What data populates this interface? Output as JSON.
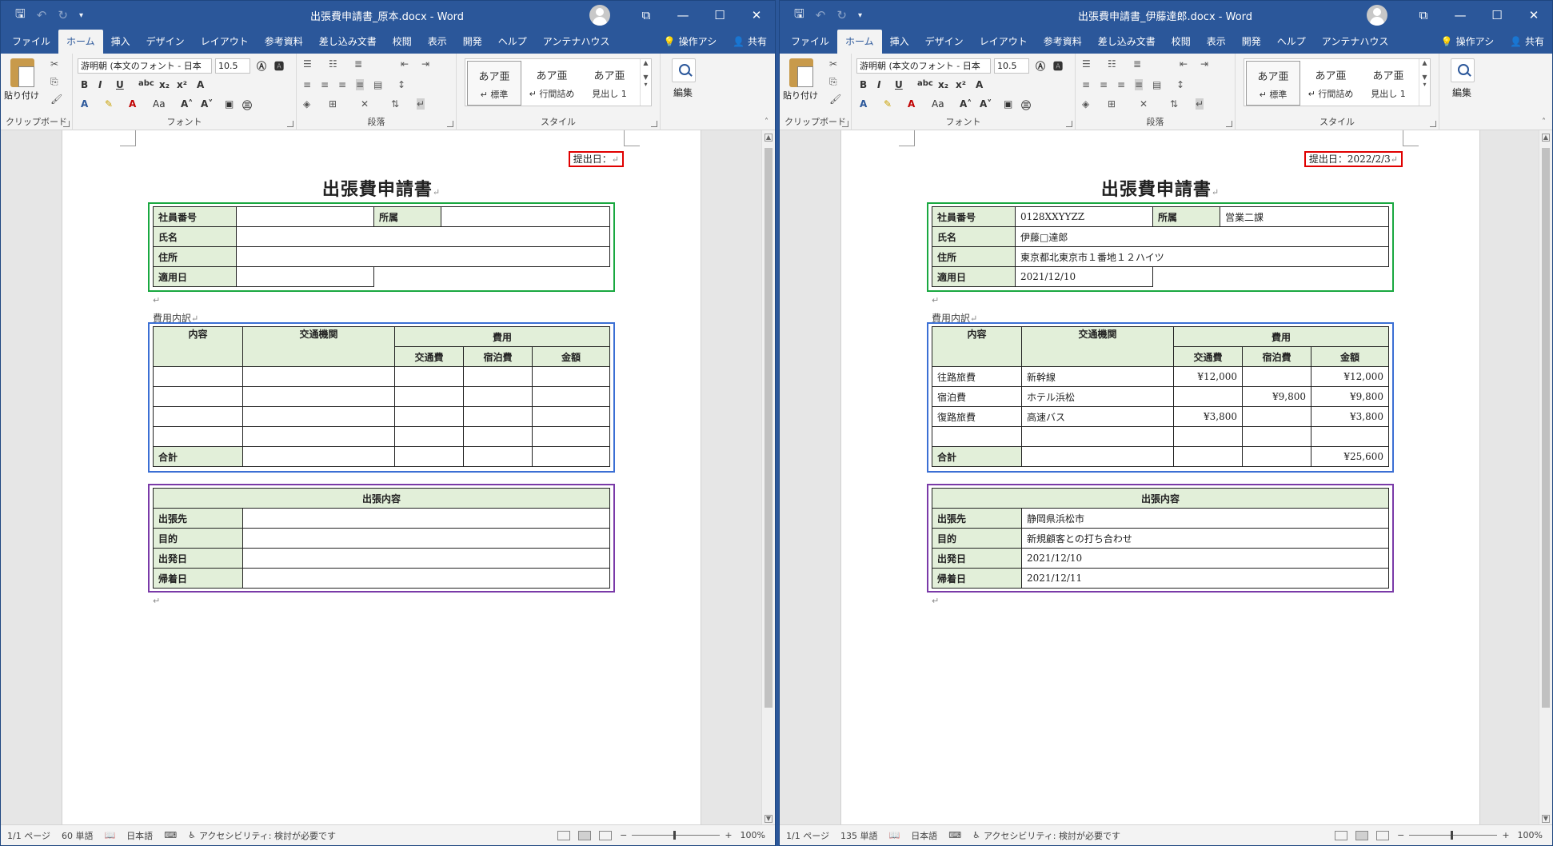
{
  "windows": [
    {
      "title": "出張費申請書_原本.docx  -  Word",
      "tabs": [
        "ファイル",
        "ホーム",
        "挿入",
        "デザイン",
        "レイアウト",
        "参考資料",
        "差し込み文書",
        "校閲",
        "表示",
        "開発",
        "ヘルプ",
        "アンテナハウス"
      ],
      "tell_me": "操作アシ",
      "share": "共有",
      "ribbon": {
        "paste": "貼り付け",
        "font_name": "游明朝 (本文のフォント - 日本",
        "font_size": "10.5",
        "clipboard": "クリップボード",
        "font": "フォント",
        "paragraph": "段落",
        "styles": "スタイル",
        "edit": "編集",
        "style_tiles": [
          {
            "sample": "あア亜",
            "name": "↵ 標準"
          },
          {
            "sample": "あア亜",
            "name": "↵ 行間詰め"
          },
          {
            "sample": "あア亜",
            "name": "見出し 1"
          }
        ]
      },
      "doc": {
        "submit_label": "提出日：",
        "title": "出張費申請書",
        "info": {
          "emp_no_label": "社員番号",
          "emp_no": "",
          "dept_label": "所属",
          "dept": "",
          "name_label": "氏名",
          "name": "",
          "addr_label": "住所",
          "addr": "",
          "apply_label": "適用日",
          "apply": ""
        },
        "expense_caption": "費用内訳",
        "expense_headers": {
          "content": "内容",
          "transport": "交通機関",
          "cost": "費用",
          "fare": "交通費",
          "lodging": "宿泊費",
          "amount": "金額"
        },
        "expense_rows": [
          {
            "content": "",
            "transport": "",
            "fare": "",
            "lodging": "",
            "amount": ""
          },
          {
            "content": "",
            "transport": "",
            "fare": "",
            "lodging": "",
            "amount": ""
          },
          {
            "content": "",
            "transport": "",
            "fare": "",
            "lodging": "",
            "amount": ""
          },
          {
            "content": "",
            "transport": "",
            "fare": "",
            "lodging": "",
            "amount": ""
          }
        ],
        "total_label": "合計",
        "total": "",
        "trip_header": "出張内容",
        "trip": {
          "dest_label": "出張先",
          "dest": "",
          "purpose_label": "目的",
          "purpose": "",
          "depart_label": "出発日",
          "depart": "",
          "return_label": "帰着日",
          "return": ""
        }
      },
      "status": {
        "page": "1/1 ページ",
        "words": "60 単語",
        "lang": "日本語",
        "access": "アクセシビリティ: 検討が必要です",
        "zoom": "100%"
      }
    },
    {
      "title": "出張費申請書_伊藤達郎.docx  -  Word",
      "tabs": [
        "ファイル",
        "ホーム",
        "挿入",
        "デザイン",
        "レイアウト",
        "参考資料",
        "差し込み文書",
        "校閲",
        "表示",
        "開発",
        "ヘルプ",
        "アンテナハウス"
      ],
      "tell_me": "操作アシ",
      "share": "共有",
      "ribbon": {
        "paste": "貼り付け",
        "font_name": "游明朝 (本文のフォント - 日本",
        "font_size": "10.5",
        "clipboard": "クリップボード",
        "font": "フォント",
        "paragraph": "段落",
        "styles": "スタイル",
        "edit": "編集",
        "style_tiles": [
          {
            "sample": "あア亜",
            "name": "↵ 標準"
          },
          {
            "sample": "あア亜",
            "name": "↵ 行間詰め"
          },
          {
            "sample": "あア亜",
            "name": "見出し 1"
          }
        ]
      },
      "doc": {
        "submit_label": "提出日：2022/2/3",
        "title": "出張費申請書",
        "info": {
          "emp_no_label": "社員番号",
          "emp_no": "0128XXYYZZ",
          "dept_label": "所属",
          "dept": "営業二課",
          "name_label": "氏名",
          "name": "伊藤□達郎",
          "addr_label": "住所",
          "addr": "東京都北東京市１番地１２ハイツ",
          "apply_label": "適用日",
          "apply": "2021/12/10"
        },
        "expense_caption": "費用内訳",
        "expense_headers": {
          "content": "内容",
          "transport": "交通機関",
          "cost": "費用",
          "fare": "交通費",
          "lodging": "宿泊費",
          "amount": "金額"
        },
        "expense_rows": [
          {
            "content": "往路旅費",
            "transport": "新幹線",
            "fare": "¥12,000",
            "lodging": "",
            "amount": "¥12,000"
          },
          {
            "content": "宿泊費",
            "transport": "ホテル浜松",
            "fare": "",
            "lodging": "¥9,800",
            "amount": "¥9,800"
          },
          {
            "content": "復路旅費",
            "transport": "高速バス",
            "fare": "¥3,800",
            "lodging": "",
            "amount": "¥3,800"
          },
          {
            "content": "",
            "transport": "",
            "fare": "",
            "lodging": "",
            "amount": ""
          }
        ],
        "total_label": "合計",
        "total": "¥25,600",
        "trip_header": "出張内容",
        "trip": {
          "dest_label": "出張先",
          "dest": "静岡県浜松市",
          "purpose_label": "目的",
          "purpose": "新規顧客との打ち合わせ",
          "depart_label": "出発日",
          "depart": "2021/12/10",
          "return_label": "帰着日",
          "return": "2021/12/11"
        }
      },
      "status": {
        "page": "1/1 ページ",
        "words": "135 単語",
        "lang": "日本語",
        "access": "アクセシビリティ: 検討が必要です",
        "zoom": "100%"
      }
    }
  ],
  "colors": {
    "titlebar": "#2b579a",
    "label_fill": "#e2efd9",
    "frame_red": "#e00000",
    "frame_green": "#19a840",
    "frame_blue": "#3b6fd4",
    "frame_purple": "#7a3aa8"
  },
  "icons": [
    "save-icon",
    "undo-icon",
    "redo-icon",
    "customize-icon",
    "avatar-icon",
    "ribbon-display-icon",
    "minimize-icon",
    "maximize-icon",
    "close-icon",
    "lightbulb-icon",
    "person-icon",
    "search-icon"
  ]
}
